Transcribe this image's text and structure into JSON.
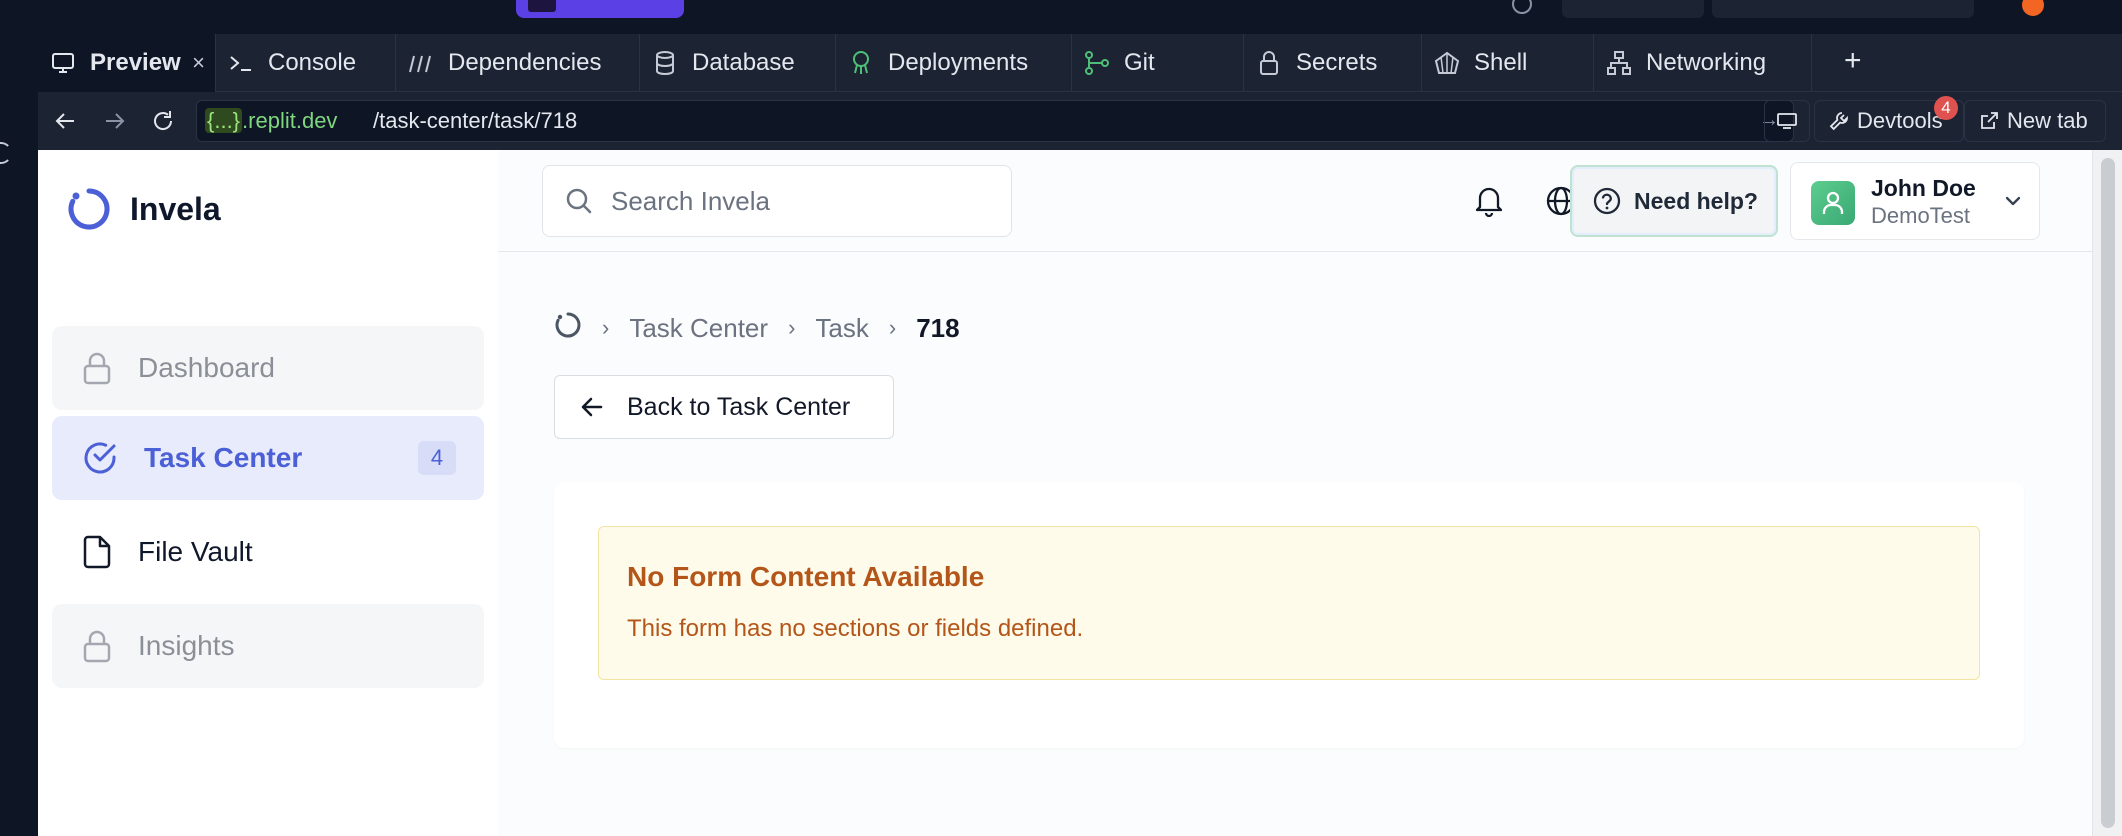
{
  "browser": {
    "tabs": [
      {
        "label": "Preview",
        "icon": "monitor-icon"
      },
      {
        "label": "Console",
        "icon": "terminal-icon"
      },
      {
        "label": "Dependencies",
        "icon": "dependencies-icon"
      },
      {
        "label": "Database",
        "icon": "database-icon"
      },
      {
        "label": "Deployments",
        "icon": "deployments-icon"
      },
      {
        "label": "Git",
        "icon": "git-icon"
      },
      {
        "label": "Secrets",
        "icon": "lock-icon"
      },
      {
        "label": "Shell",
        "icon": "shell-icon"
      },
      {
        "label": "Networking",
        "icon": "networking-icon"
      }
    ],
    "close_glyph": "×",
    "plus_glyph": "+",
    "kebab_glyph": "⋮",
    "url_host_braces": "{...}",
    "url_host_domain": ".replit.dev",
    "url_path": "/task-center/task/718",
    "devtools_label": "Devtools",
    "devtools_badge": "4",
    "newtab_label": "New tab"
  },
  "app": {
    "name": "Invela",
    "accent": "#4b5fd6",
    "sidebar": {
      "items": [
        {
          "label": "Dashboard",
          "state": "locked"
        },
        {
          "label": "Task Center",
          "state": "active",
          "badge": "4"
        },
        {
          "label": "File Vault",
          "state": "plain"
        },
        {
          "label": "Insights",
          "state": "locked"
        }
      ]
    },
    "header": {
      "search_placeholder": "Search Invela",
      "help_label": "Need help?",
      "user_name": "John Doe",
      "user_org": "DemoTest"
    },
    "breadcrumb": {
      "items": [
        "Task Center",
        "Task"
      ],
      "current": "718"
    },
    "back_label": "Back to Task Center",
    "alert": {
      "title": "No Form Content Available",
      "body": "This form has no sections or fields defined.",
      "color": "#b4561a"
    }
  }
}
